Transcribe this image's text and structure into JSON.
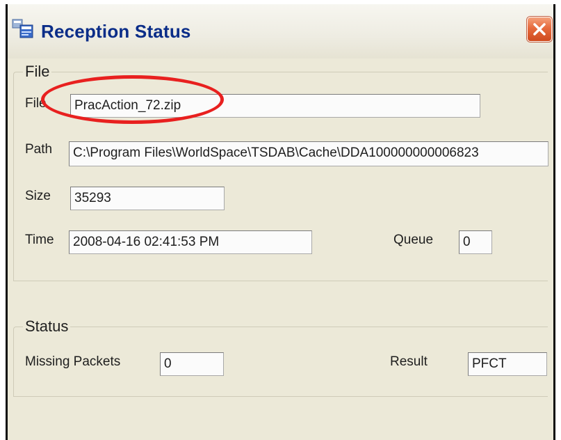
{
  "window": {
    "title": "Reception Status",
    "icon": "app-window-icon",
    "close_icon": "close-icon"
  },
  "file_group": {
    "legend": "File",
    "file_label": "File",
    "file_value": "PracAction_72.zip",
    "path_label": "Path",
    "path_value": "C:\\Program Files\\WorldSpace\\TSDAB\\Cache\\DDA100000000006823",
    "size_label": "Size",
    "size_value": "35293",
    "time_label": "Time",
    "time_value": "2008-04-16  02:41:53 PM",
    "queue_label": "Queue",
    "queue_value": "0"
  },
  "status_group": {
    "legend": "Status",
    "missing_packets_label": "Missing Packets",
    "missing_packets_value": "0",
    "result_label": "Result",
    "result_value": "PFCT"
  },
  "annotation": {
    "color": "#e8201f"
  }
}
